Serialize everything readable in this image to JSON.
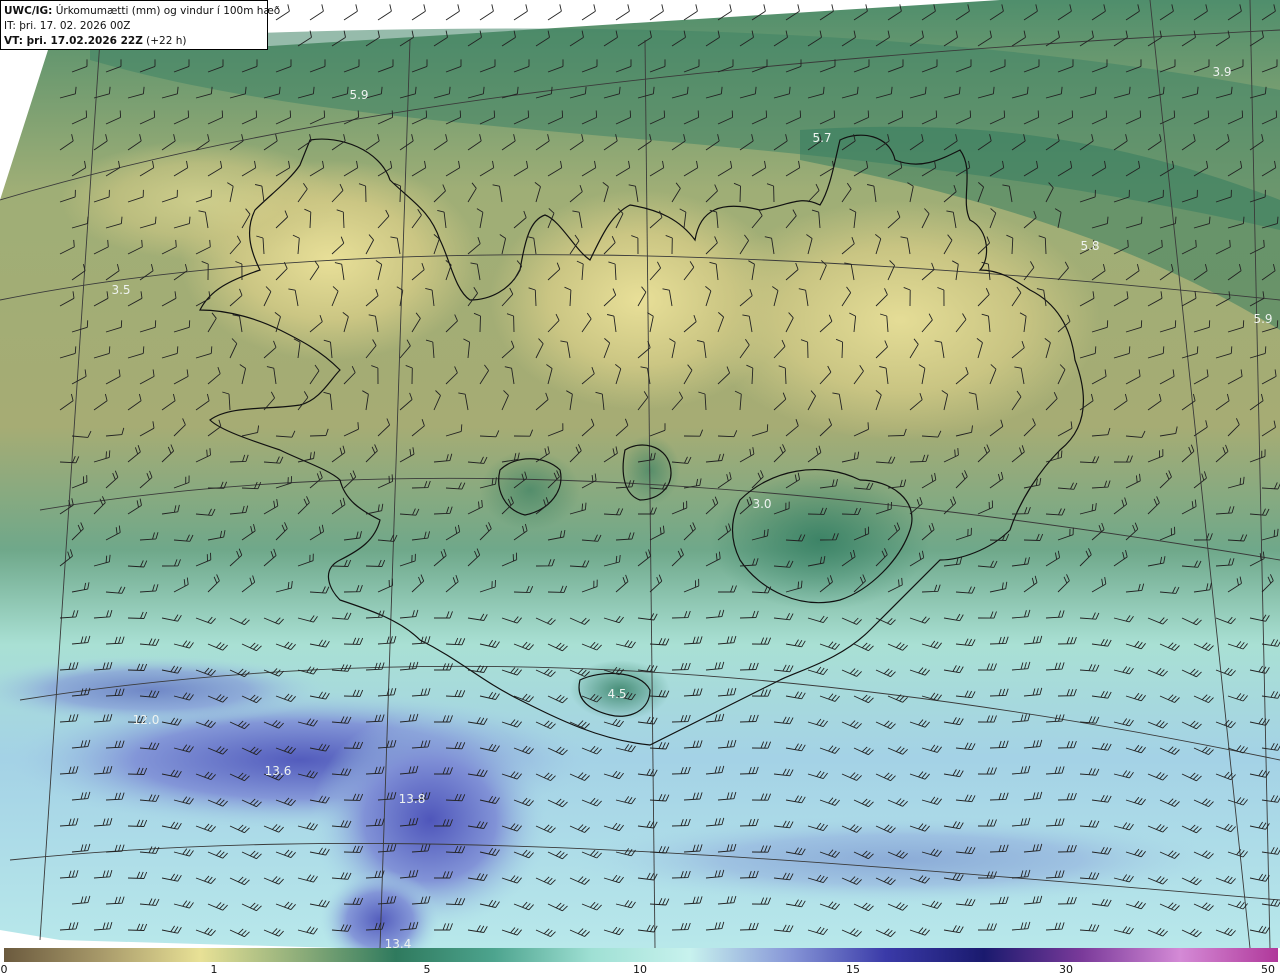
{
  "header": {
    "model": "UWC/IG:",
    "title": "Úrkomumætti (mm) og vindur í 100m hæð",
    "init_time": "IT: þri. 17. 02. 2026 00Z",
    "valid_prefix": "VT: þri. 17.02.2026 22Z",
    "valid_suffix": "(+22 h)"
  },
  "field_labels": [
    {
      "text": "5.9",
      "lon_hint": "nw-sea"
    },
    {
      "text": "5.7",
      "lon_hint": "north-coast"
    },
    {
      "text": "3.9",
      "lon_hint": "ne-corner"
    },
    {
      "text": "5.8",
      "lon_hint": "ne-sea"
    },
    {
      "text": "5.9",
      "lon_hint": "east-edge"
    },
    {
      "text": "3.5",
      "lon_hint": "west-sea"
    },
    {
      "text": "3.0",
      "lon_hint": "vatnajokull"
    },
    {
      "text": "4.5",
      "lon_hint": "myrdalsjokull"
    },
    {
      "text": "12.0",
      "lon_hint": "sw-sea"
    },
    {
      "text": "13.6",
      "lon_hint": "sw-sea-2"
    },
    {
      "text": "13.8",
      "lon_hint": "south-sea"
    },
    {
      "text": "13.4",
      "lon_hint": "south-edge"
    }
  ],
  "colorbar": {
    "ticks": [
      "0",
      "1",
      "5",
      "10",
      "15",
      "30",
      "50"
    ],
    "stops": [
      "#6b5a3e",
      "#a89a6a",
      "#e8e196",
      "#8fae7a",
      "#2f7a5e",
      "#4da48e",
      "#9fe0d4",
      "#c8f2ee",
      "#8898d8",
      "#3a3aa8",
      "#1a1a6e",
      "#7a3a9a",
      "#d48ad6",
      "#b0389a"
    ]
  },
  "colors": {
    "land_outline": "#111111",
    "barb": "#222222",
    "grid": "#3a3a3a"
  }
}
